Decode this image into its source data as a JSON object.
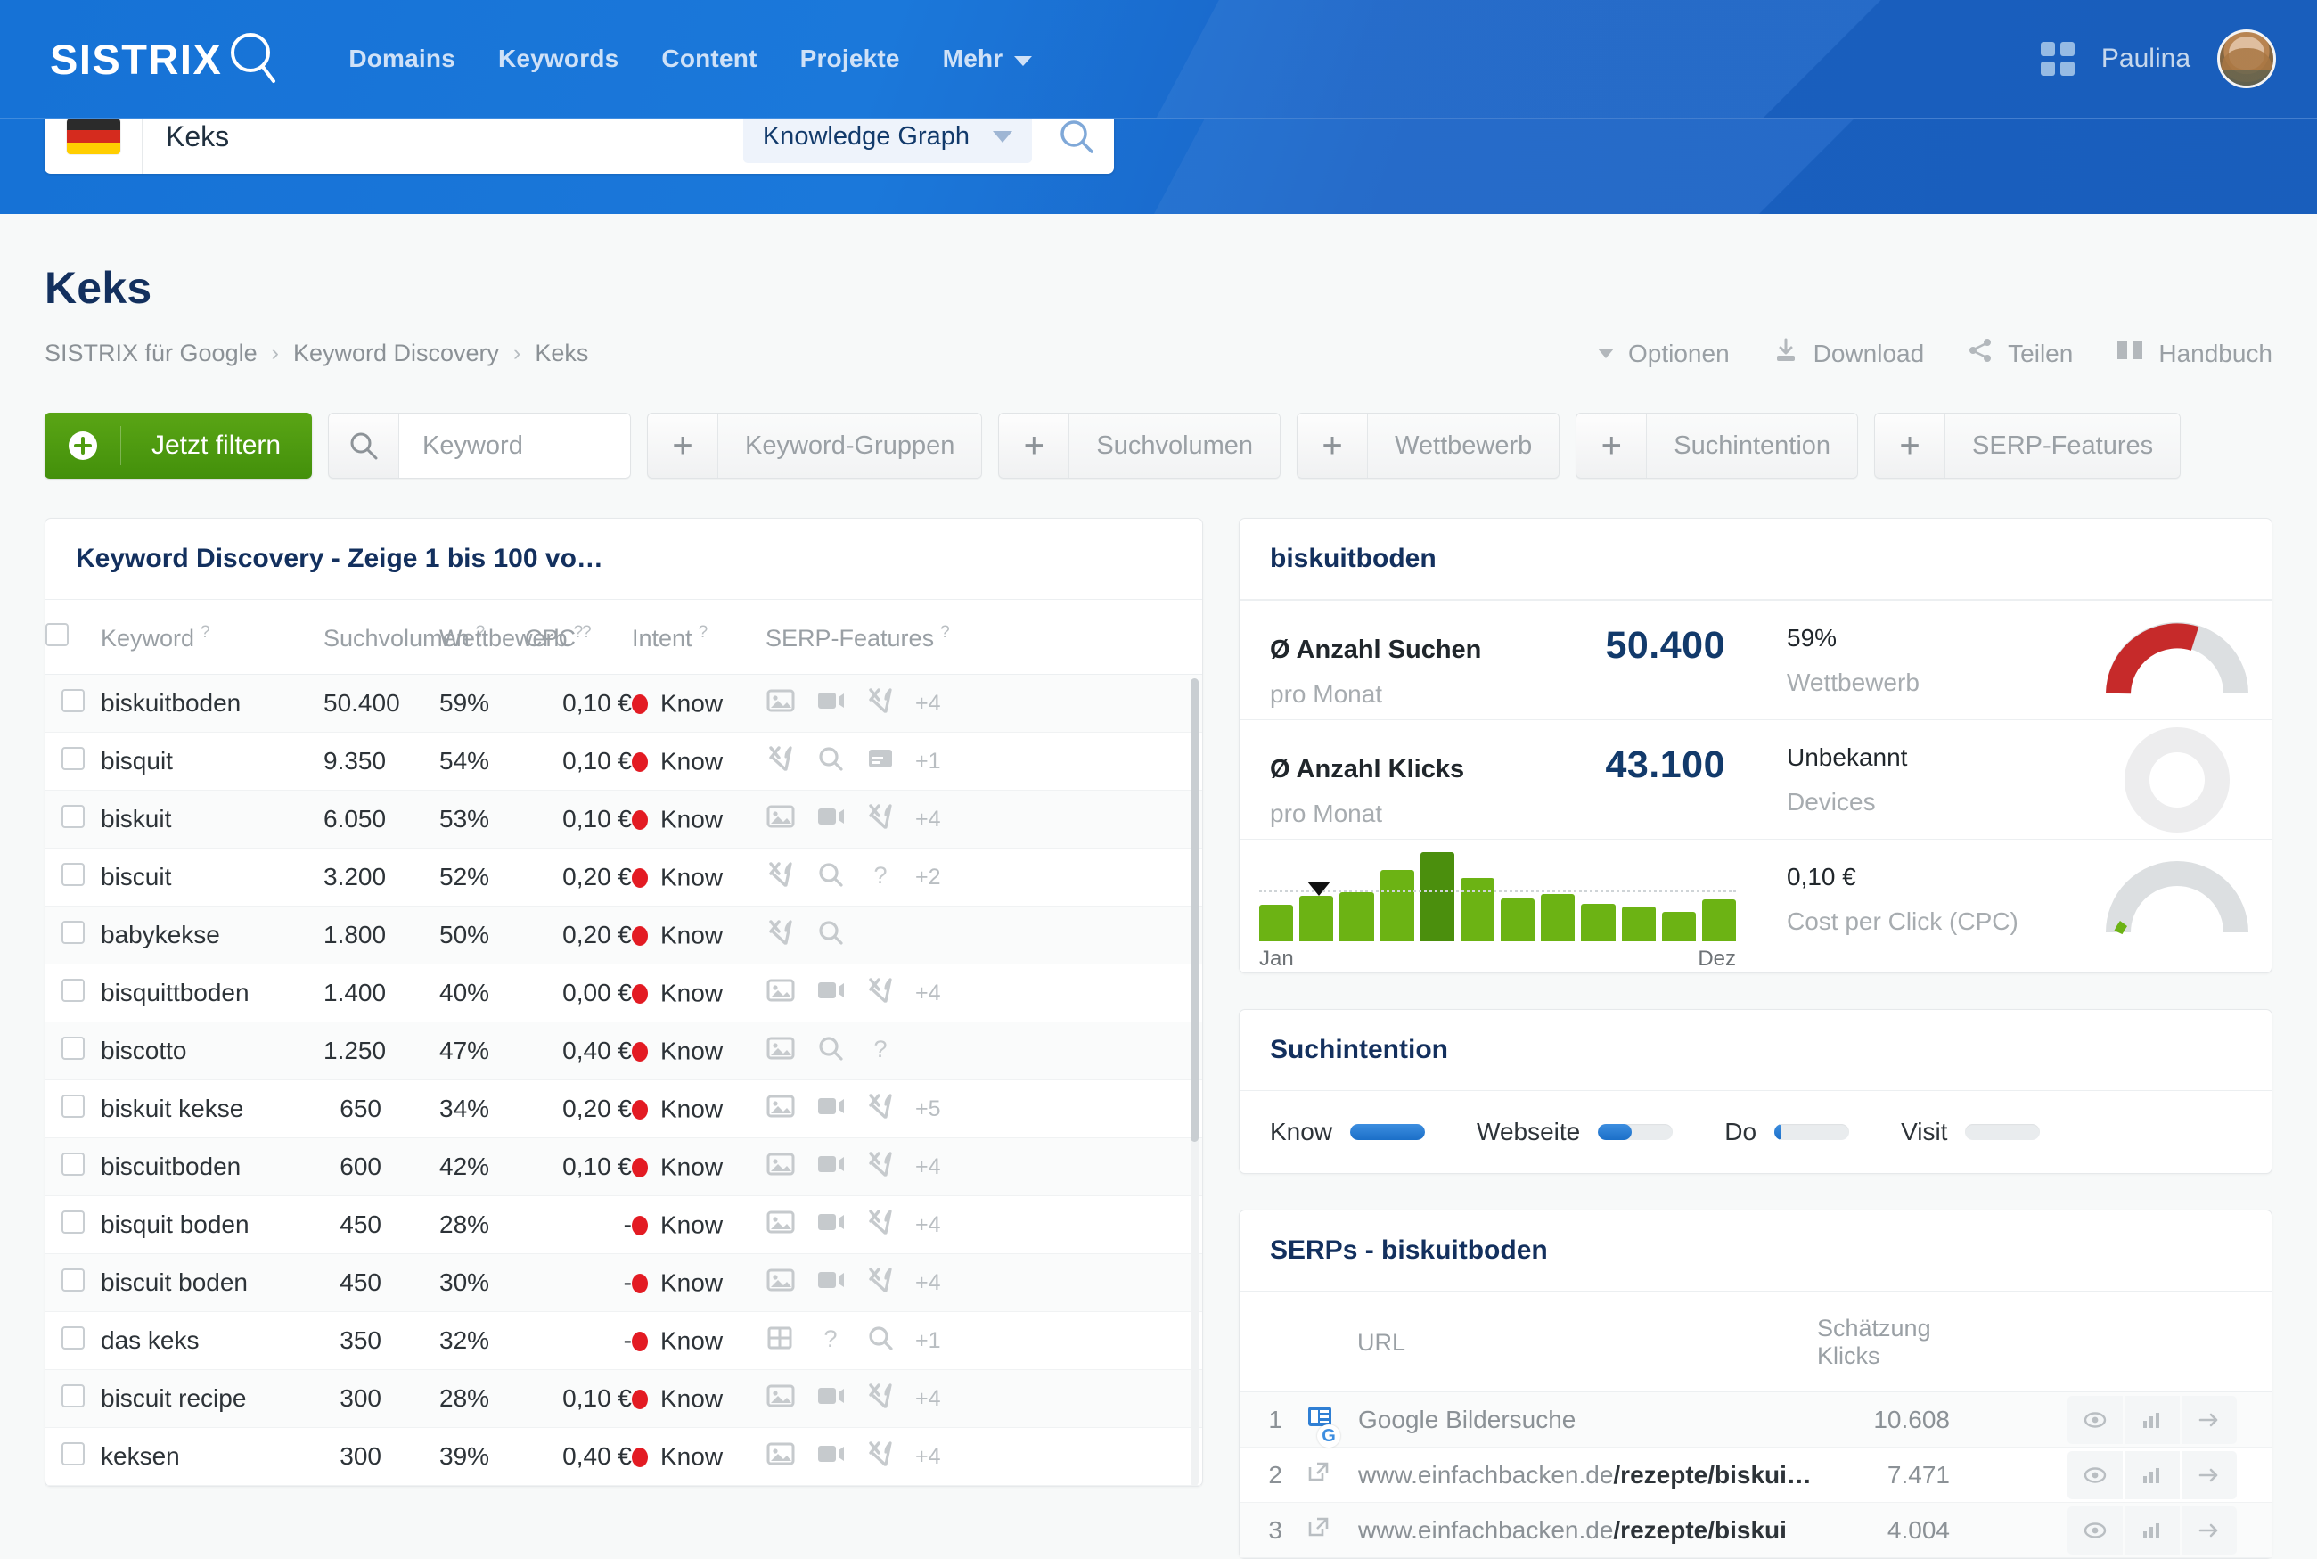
{
  "header": {
    "logo_text": "SISTRIX",
    "nav": [
      {
        "label": "Domains"
      },
      {
        "label": "Keywords"
      },
      {
        "label": "Content"
      },
      {
        "label": "Projekte"
      },
      {
        "label": "Mehr"
      }
    ],
    "username": "Paulina"
  },
  "search": {
    "value": "Keks",
    "country_flag": "de-flag-icon",
    "mode_label": "Knowledge Graph"
  },
  "page": {
    "title": "Keks",
    "breadcrumb": [
      "SISTRIX für Google",
      "Keyword Discovery",
      "Keks"
    ],
    "actions": [
      {
        "label": "Optionen",
        "icon": "caret-down-icon"
      },
      {
        "label": "Download",
        "icon": "download-icon"
      },
      {
        "label": "Teilen",
        "icon": "share-icon"
      },
      {
        "label": "Handbuch",
        "icon": "book-icon"
      }
    ]
  },
  "filters": {
    "apply_label": "Jetzt filtern",
    "keyword_placeholder": "Keyword",
    "chips": [
      {
        "label": "Keyword-Gruppen"
      },
      {
        "label": "Suchvolumen"
      },
      {
        "label": "Wettbewerb"
      },
      {
        "label": "Suchintention"
      },
      {
        "label": "SERP-Features"
      }
    ]
  },
  "keyword_table": {
    "title": "Keyword Discovery - Zeige 1 bis 100 vo…",
    "columns": [
      "Keyword",
      "Suchvolumen",
      "Wettbewerb",
      "CPC",
      "Intent",
      "SERP-Features"
    ],
    "rows": [
      {
        "keyword": "biskuitboden",
        "volume": "50.400",
        "volume_pct": 100,
        "competition": "59%",
        "competition_pct": 59,
        "cpc": "0,10 €",
        "intent": "Know",
        "serp_icons": [
          "image-icon",
          "video-icon",
          "recipe-icon"
        ],
        "serp_more": "+4"
      },
      {
        "keyword": "bisquit",
        "volume": "9.350",
        "volume_pct": 62,
        "competition": "54%",
        "competition_pct": 54,
        "cpc": "0,10 €",
        "intent": "Know",
        "serp_icons": [
          "recipe-icon",
          "search-icon",
          "news-icon"
        ],
        "serp_more": "+1"
      },
      {
        "keyword": "biskuit",
        "volume": "6.050",
        "volume_pct": 56,
        "competition": "53%",
        "competition_pct": 53,
        "cpc": "0,10 €",
        "intent": "Know",
        "serp_icons": [
          "image-icon",
          "video-icon",
          "recipe-icon"
        ],
        "serp_more": "+4"
      },
      {
        "keyword": "biscuit",
        "volume": "3.200",
        "volume_pct": 46,
        "competition": "52%",
        "competition_pct": 52,
        "cpc": "0,20 €",
        "intent": "Know",
        "serp_icons": [
          "recipe-icon",
          "search-icon",
          "faq-icon"
        ],
        "serp_more": "+2"
      },
      {
        "keyword": "babykekse",
        "volume": "1.800",
        "volume_pct": 37,
        "competition": "50%",
        "competition_pct": 50,
        "cpc": "0,20 €",
        "intent": "Know",
        "serp_icons": [
          "recipe-icon",
          "search-icon"
        ],
        "serp_more": ""
      },
      {
        "keyword": "bisquittboden",
        "volume": "1.400",
        "volume_pct": 33,
        "competition": "40%",
        "competition_pct": 40,
        "cpc": "0,00 €",
        "intent": "Know",
        "serp_icons": [
          "image-icon",
          "video-icon",
          "recipe-icon"
        ],
        "serp_more": "+4"
      },
      {
        "keyword": "biscotto",
        "volume": "1.250",
        "volume_pct": 31,
        "competition": "47%",
        "competition_pct": 47,
        "cpc": "0,40 €",
        "intent": "Know",
        "serp_icons": [
          "image-icon",
          "search-icon",
          "faq-icon"
        ],
        "serp_more": ""
      },
      {
        "keyword": "biskuit kekse",
        "volume": "650",
        "volume_pct": 24,
        "competition": "34%",
        "competition_pct": 34,
        "cpc": "0,20 €",
        "intent": "Know",
        "serp_icons": [
          "image-icon",
          "video-icon",
          "recipe-icon"
        ],
        "serp_more": "+5"
      },
      {
        "keyword": "biscuitboden",
        "volume": "600",
        "volume_pct": 23,
        "competition": "42%",
        "competition_pct": 42,
        "cpc": "0,10 €",
        "intent": "Know",
        "serp_icons": [
          "image-icon",
          "video-icon",
          "recipe-icon"
        ],
        "serp_more": "+4"
      },
      {
        "keyword": "bisquit boden",
        "volume": "450",
        "volume_pct": 20,
        "competition": "28%",
        "competition_pct": 28,
        "cpc": "-",
        "intent": "Know",
        "serp_icons": [
          "image-icon",
          "video-icon",
          "recipe-icon"
        ],
        "serp_more": "+4"
      },
      {
        "keyword": "biscuit boden",
        "volume": "450",
        "volume_pct": 20,
        "competition": "30%",
        "competition_pct": 30,
        "cpc": "-",
        "intent": "Know",
        "serp_icons": [
          "image-icon",
          "video-icon",
          "recipe-icon"
        ],
        "serp_more": "+4"
      },
      {
        "keyword": "das keks",
        "volume": "350",
        "volume_pct": 18,
        "competition": "32%",
        "competition_pct": 32,
        "cpc": "-",
        "intent": "Know",
        "serp_icons": [
          "grid-icon",
          "faq-icon",
          "search-icon"
        ],
        "serp_more": "+1"
      },
      {
        "keyword": "biscuit recipe",
        "volume": "300",
        "volume_pct": 17,
        "competition": "28%",
        "competition_pct": 28,
        "cpc": "0,10 €",
        "intent": "Know",
        "serp_icons": [
          "image-icon",
          "video-icon",
          "recipe-icon"
        ],
        "serp_more": "+4"
      },
      {
        "keyword": "keksen",
        "volume": "300",
        "volume_pct": 17,
        "competition": "39%",
        "competition_pct": 39,
        "cpc": "0,40 €",
        "intent": "Know",
        "serp_icons": [
          "image-icon",
          "video-icon",
          "recipe-icon"
        ],
        "serp_more": "+4"
      }
    ]
  },
  "metrics_card": {
    "title": "biskuitboden",
    "searches_label": "Ø Anzahl Suchen",
    "searches_value": "50.400",
    "searches_sub": "pro Monat",
    "clicks_label": "Ø Anzahl Klicks",
    "clicks_value": "43.100",
    "clicks_sub": "pro Monat",
    "competition_value": "59%",
    "competition_label": "Wettbewerb",
    "devices_value": "Unbekannt",
    "devices_label": "Devices",
    "cpc_value": "0,10 €",
    "cpc_label": "Cost per Click (CPC)",
    "competition_color": "#c62a2a",
    "cpc_color": "#6cb314"
  },
  "chart_data": {
    "type": "bar",
    "title": "Ø Anzahl Suchen pro Monat",
    "categories": [
      "Jan",
      "Feb",
      "Mär",
      "Apr",
      "Mai",
      "Jun",
      "Jul",
      "Aug",
      "Sep",
      "Okt",
      "Nov",
      "Dez"
    ],
    "values": [
      27,
      34,
      36,
      53,
      66,
      47,
      32,
      35,
      28,
      26,
      22,
      31
    ],
    "axis_labels": [
      "Jan",
      "Dez"
    ],
    "highlight_index": 4,
    "marker_index": 1,
    "average_line": 36,
    "bar_color": "#6cb314",
    "highlight_color": "#4b8f0d",
    "xlabel": "",
    "ylabel": "",
    "grid": false
  },
  "intent_card": {
    "title": "Suchintention",
    "items": [
      {
        "label": "Know",
        "pct": 100
      },
      {
        "label": "Webseite",
        "pct": 45
      },
      {
        "label": "Do",
        "pct": 10
      },
      {
        "label": "Visit",
        "pct": 0
      }
    ]
  },
  "serp_card": {
    "title": "SERPs - biskuitboden",
    "columns": [
      "URL",
      "Schätzung Klicks"
    ],
    "rows": [
      {
        "rank": "1",
        "icon": "google-images-icon",
        "url_prefix": "Google Bildersuche",
        "url_path": "",
        "clicks": "10.608",
        "clicks_pct": 100
      },
      {
        "rank": "2",
        "icon": "external-link-icon",
        "url_prefix": "www.einfachbacken.de",
        "url_path": "/rezepte/biskui…",
        "clicks": "7.471",
        "clicks_pct": 70
      },
      {
        "rank": "3",
        "icon": "external-link-icon",
        "url_prefix": "www.einfachbacken.de",
        "url_path": "/rezepte/biskui",
        "clicks": "4.004",
        "clicks_pct": 40
      }
    ],
    "row_actions": [
      "eye-icon",
      "chart-icon",
      "arrow-right-icon"
    ]
  }
}
